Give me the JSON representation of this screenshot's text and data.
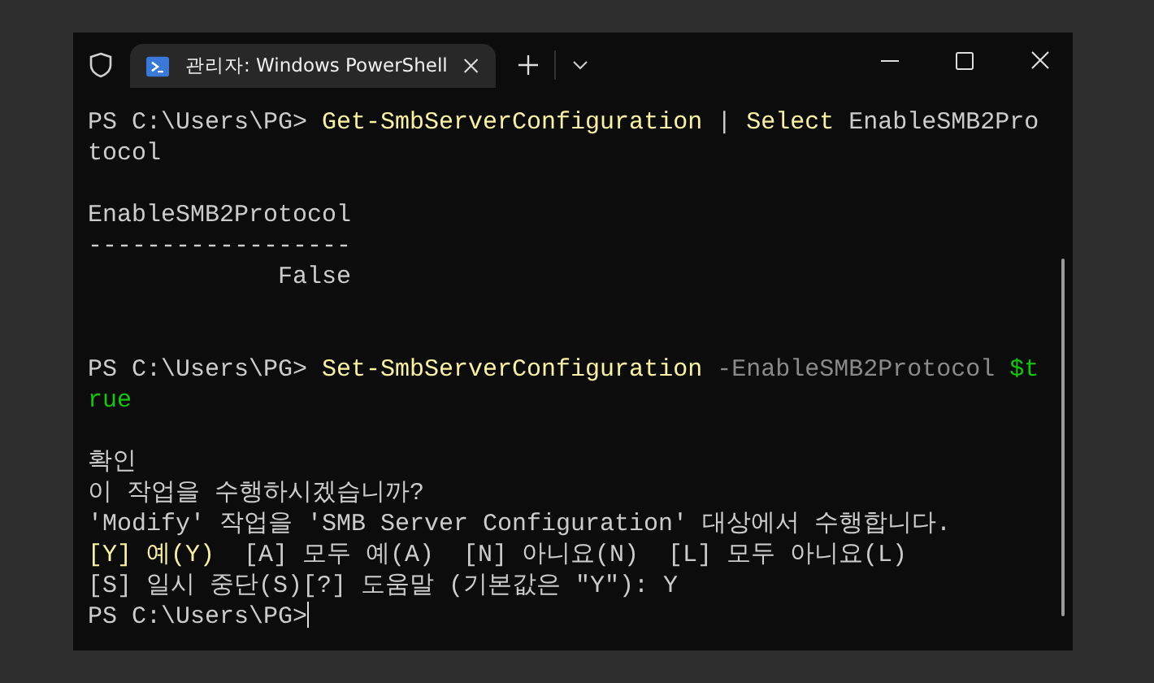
{
  "window": {
    "tab_title": "관리자: Windows PowerShell"
  },
  "lines": [
    {
      "kind": "text",
      "segments": [
        {
          "text": "PS C:\\Users\\PG> ",
          "kind": "prompt"
        },
        {
          "text": "Get-SmbServerConfiguration",
          "kind": "command"
        },
        {
          "text": " | ",
          "kind": "plain"
        },
        {
          "text": "Select",
          "kind": "command"
        },
        {
          "text": " EnableSMB2Pro",
          "kind": "plain"
        }
      ]
    },
    {
      "kind": "text",
      "segments": [
        {
          "text": "tocol",
          "kind": "plain"
        }
      ]
    },
    {
      "kind": "blank"
    },
    {
      "kind": "text",
      "segments": [
        {
          "text": "EnableSMB2Protocol",
          "kind": "plain"
        }
      ]
    },
    {
      "kind": "text",
      "segments": [
        {
          "text": "------------------",
          "kind": "plain"
        }
      ]
    },
    {
      "kind": "text",
      "segments": [
        {
          "text": "             False",
          "kind": "plain"
        }
      ]
    },
    {
      "kind": "blank"
    },
    {
      "kind": "blank"
    },
    {
      "kind": "text",
      "segments": [
        {
          "text": "PS C:\\Users\\PG> ",
          "kind": "prompt"
        },
        {
          "text": "Set-SmbServerConfiguration",
          "kind": "command"
        },
        {
          "text": " -EnableSMB2Protocol ",
          "kind": "parameter"
        },
        {
          "text": "$t",
          "kind": "variable"
        }
      ]
    },
    {
      "kind": "text",
      "segments": [
        {
          "text": "rue",
          "kind": "variable"
        }
      ]
    },
    {
      "kind": "blank"
    },
    {
      "kind": "text",
      "segments": [
        {
          "text": "확인",
          "kind": "plain"
        }
      ]
    },
    {
      "kind": "text",
      "segments": [
        {
          "text": "이 작업을 수행하시겠습니까?",
          "kind": "plain"
        }
      ]
    },
    {
      "kind": "text",
      "segments": [
        {
          "text": "'Modify' 작업을 'SMB Server Configuration' 대상에서 수행합니다.",
          "kind": "plain"
        }
      ]
    },
    {
      "kind": "text",
      "segments": [
        {
          "text": "[Y] 예(Y)",
          "kind": "command"
        },
        {
          "text": "  [A] 모두 예(A)  [N] 아니요(N)  [L] 모두 아니요(L)",
          "kind": "plain"
        }
      ]
    },
    {
      "kind": "text",
      "segments": [
        {
          "text": "[S] 일시 중단(S)[?] 도움말 (기본값은 \"Y\"): Y",
          "kind": "plain"
        }
      ]
    },
    {
      "kind": "text",
      "cursor": true,
      "segments": [
        {
          "text": "PS C:\\Users\\PG>",
          "kind": "prompt"
        }
      ]
    }
  ]
}
